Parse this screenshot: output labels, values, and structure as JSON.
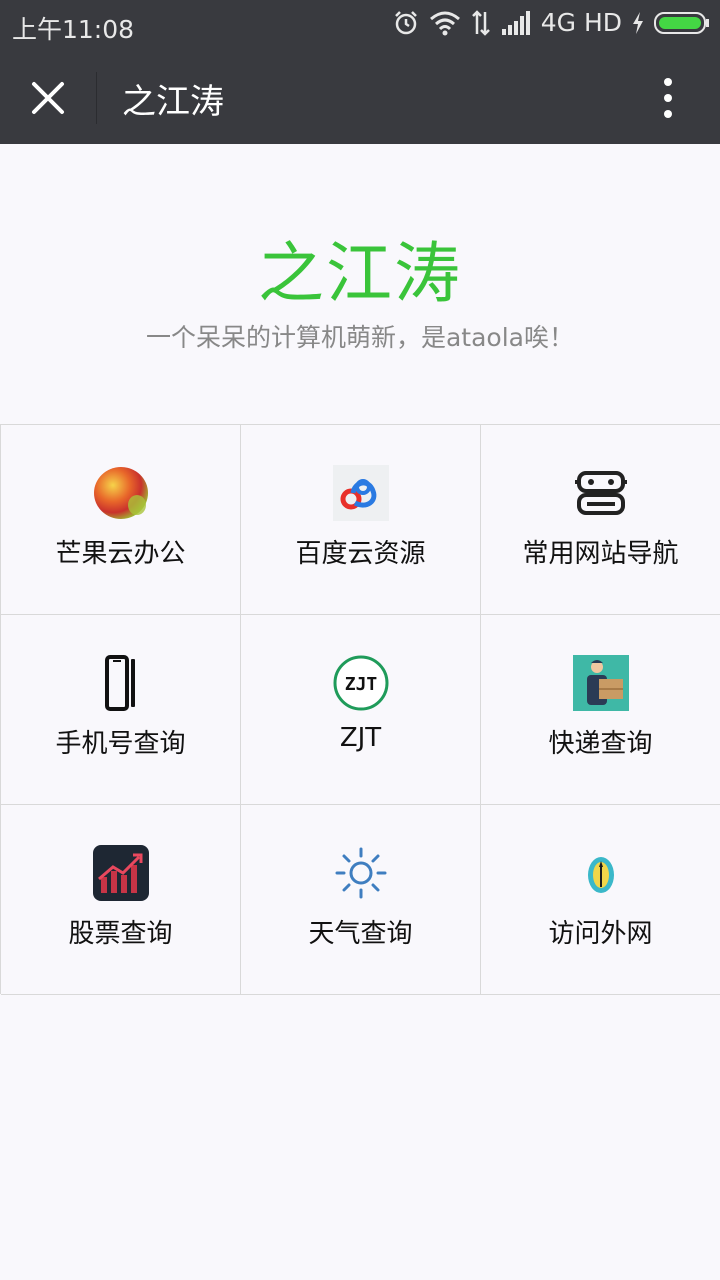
{
  "status_bar": {
    "time": "上午11:08",
    "network": "4G HD"
  },
  "title_bar": {
    "title": "之江涛"
  },
  "hero": {
    "title": "之江涛",
    "subtitle": "一个呆呆的计算机萌新，是ataola唉！"
  },
  "grid": [
    {
      "label": "芒果云办公",
      "icon": "mango-icon"
    },
    {
      "label": "百度云资源",
      "icon": "baidu-cloud-icon"
    },
    {
      "label": "常用网站导航",
      "icon": "robot-navigation-icon"
    },
    {
      "label": "手机号查询",
      "icon": "phone-icon"
    },
    {
      "label": "ZJT",
      "icon": "zjt-logo-icon"
    },
    {
      "label": "快递查询",
      "icon": "delivery-person-icon"
    },
    {
      "label": "股票查询",
      "icon": "stock-chart-icon"
    },
    {
      "label": "天气查询",
      "icon": "sun-icon"
    },
    {
      "label": "访问外网",
      "icon": "rocket-icon"
    }
  ],
  "colors": {
    "accent_green": "#3ac43a",
    "header_bg": "#393a3f",
    "page_bg": "#f9f8fc"
  }
}
